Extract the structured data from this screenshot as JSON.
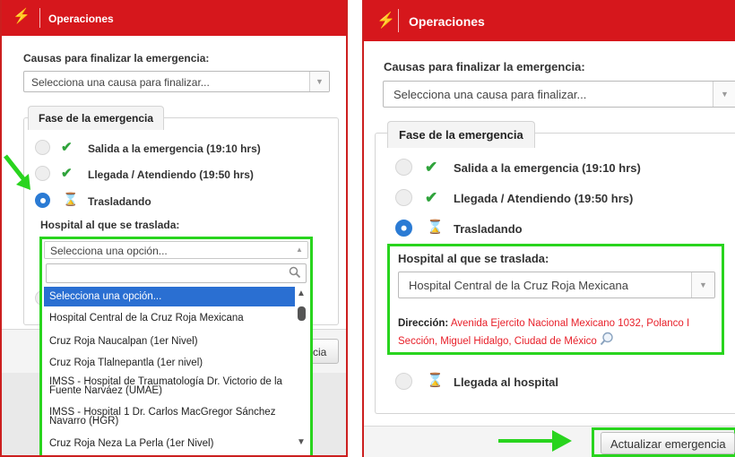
{
  "left_panel": {
    "title": "Operaciones",
    "causes_label": "Causas para finalizar la emergencia:",
    "causes_placeholder": "Selecciona una causa para finalizar...",
    "phase_legend": "Fase de la emergencia",
    "phases": [
      {
        "label": "Salida a la emergencia (19:10 hrs)",
        "status": "done",
        "selected": false
      },
      {
        "label": "Llegada / Atendiendo (19:50 hrs)",
        "status": "done",
        "selected": false
      },
      {
        "label": "Trasladando",
        "status": "pending",
        "selected": true
      }
    ],
    "hospital_label": "Hospital al que se traslada:",
    "hospital_select_value": "Selecciona una opción...",
    "hospital_search_value": "",
    "hospital_options": [
      "Selecciona una opción...",
      "Hospital Central de la Cruz Roja Mexicana",
      "Cruz Roja Naucalpan (1er Nivel)",
      "Cruz Roja Tlalnepantla (1er nivel)",
      "IMSS - Hospital de Traumatología Dr. Victorio de la Fuente Narváez (UMAE)",
      "IMSS - Hospital 1 Dr. Carlos MacGregor Sánchez Navarro (HGR)",
      "Cruz Roja Neza La Perla (1er Nivel)"
    ],
    "highlighted_option": 0,
    "partial_button_text": "cia"
  },
  "right_panel": {
    "title": "Operaciones",
    "causes_label": "Causas para finalizar la emergencia:",
    "causes_placeholder": "Selecciona una causa para finalizar...",
    "phase_legend": "Fase de la emergencia",
    "phases": [
      {
        "label": "Salida a la emergencia (19:10 hrs)",
        "status": "done",
        "selected": false
      },
      {
        "label": "Llegada / Atendiendo (19:50 hrs)",
        "status": "done",
        "selected": false
      },
      {
        "label": "Trasladando",
        "status": "pending",
        "selected": true
      },
      {
        "label": "Llegada al hospital",
        "status": "pending",
        "selected": false
      }
    ],
    "hospital_label": "Hospital al que se traslada:",
    "hospital_selected": "Hospital Central de la Cruz Roja Mexicana",
    "address_label": "Dirección:",
    "address_line1": "Avenida Ejercito Nacional Mexicano 1032, Polanco I",
    "address_line2": "Sección, Miguel Hidalgo, Ciudad de México",
    "update_button": "Actualizar emergencia"
  },
  "icons": {
    "title": "lightning-bolt-icon",
    "done": "checkmark-icon",
    "pending": "hourglass-icon",
    "address": "magnifier-icon",
    "search": "search-icon",
    "dropdown": "chevron-down-icon"
  },
  "colors": {
    "title_bar": "#d6171c",
    "bolt": "#ffd21a",
    "checkmark": "#2fa33b",
    "selected_radio": "#2b7bd4",
    "highlight_option": "#2a6fd2",
    "annotation_green": "#29d41e",
    "address_text": "#e8202a"
  }
}
